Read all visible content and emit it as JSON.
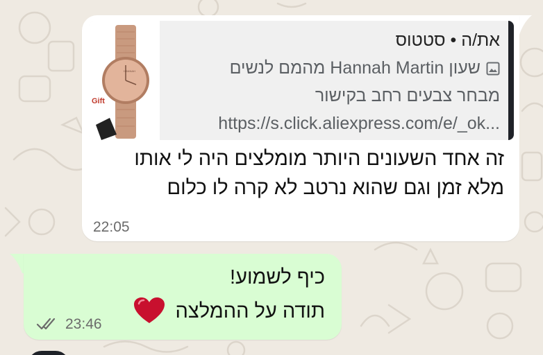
{
  "theme": {
    "chat_bg": "#efeae2",
    "incoming_bg": "#ffffff",
    "outgoing_bg": "#d9fdd3",
    "quote_bg": "#f0f0f0",
    "quote_bar": "#1f2228",
    "heart": "#c8102e",
    "ticks": "#6b6b6b"
  },
  "incoming": {
    "quote": {
      "sender": "את/ה • סטטוס",
      "media_icon": "photo-icon",
      "line1": "שעון Hannah Martin מהמם לנשים",
      "line2": "מבחר צבעים רחב בקישור",
      "line3": "https://s.click.aliexpress.com/e/_ok...",
      "thumb_label": "Gift"
    },
    "text": "זה אחד השעונים היותר מומלצים היה לי אותו מלא זמן וגם שהוא נרטב לא קרה לו כלום",
    "time": "22:05"
  },
  "outgoing": {
    "line1": "כיף לשמוע!",
    "line2": "תודה על ההמלצה",
    "emoji": "heart-emoji",
    "time": "23:46",
    "status_icon": "double-check-icon"
  }
}
